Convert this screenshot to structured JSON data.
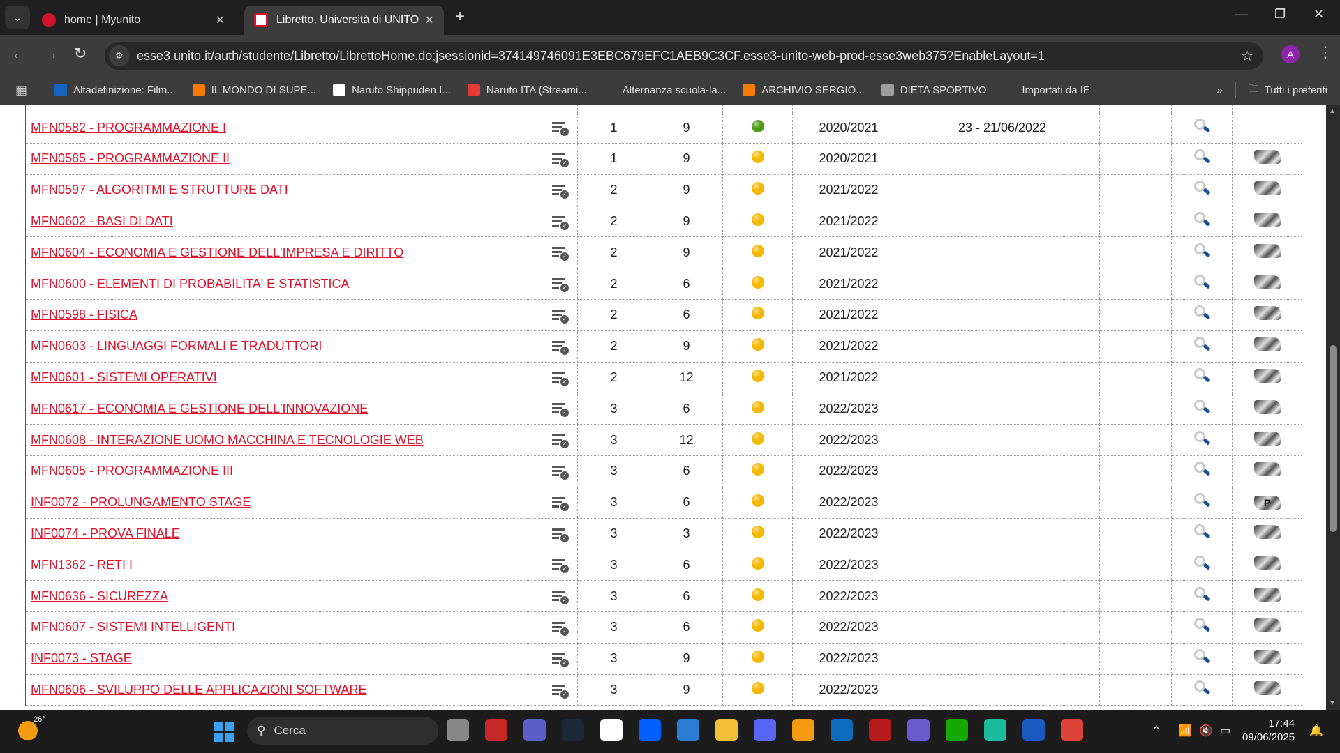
{
  "browser": {
    "tabs": [
      {
        "title": "home | Myunito",
        "active": false
      },
      {
        "title": "Libretto, Università di UNITO",
        "active": true
      }
    ],
    "url": "esse3.unito.it/auth/studente/Libretto/LibrettoHome.do;jsessionid=374149746091E3EBC679EFC1AEB9C3CF.esse3-unito-web-prod-esse3web375?EnableLayout=1",
    "profile_initial": "A",
    "bookmarks": [
      {
        "label": "Altadefinizione: Film...",
        "icon": "hd-icon",
        "color": "#1565c0",
        "glyph": "HD"
      },
      {
        "label": "IL MONDO DI SUPE...",
        "icon": "blogger-icon",
        "color": "#f57c00",
        "glyph": "B"
      },
      {
        "label": "Naruto Shippuden I...",
        "icon": "blank-page-icon",
        "color": "#ffffff",
        "glyph": ""
      },
      {
        "label": "Naruto ITA (Streami...",
        "icon": "play-icon",
        "color": "#e53935",
        "glyph": "▶"
      },
      {
        "label": "Alternanza scuola-la...",
        "icon": "4s-icon",
        "color": "#3c3c3c",
        "glyph": "4s"
      },
      {
        "label": "ARCHIVIO SERGIO...",
        "icon": "blogger-icon",
        "color": "#f57c00",
        "glyph": "B"
      },
      {
        "label": "DIETA SPORTIVO",
        "icon": "globe-icon",
        "color": "#9e9e9e",
        "glyph": ""
      },
      {
        "label": "Importati da IE",
        "icon": "folder-icon",
        "color": "#3c3c3c",
        "glyph": "🗀"
      }
    ],
    "all_bookmarks": "Tutti i preferiti"
  },
  "courses": [
    {
      "name": "MFN0582 - PROGRAMMAZIONE I",
      "year": "1",
      "cfu": "9",
      "status": "passed",
      "aa": "2020/2021",
      "grade_date": "23 - 21/06/2022",
      "book": ""
    },
    {
      "name": "MFN0585 - PROGRAMMAZIONE II",
      "year": "1",
      "cfu": "9",
      "status": "planned",
      "aa": "2020/2021",
      "grade_date": "",
      "book": "book"
    },
    {
      "name": "MFN0597 - ALGORITMI E STRUTTURE DATI",
      "year": "2",
      "cfu": "9",
      "status": "planned",
      "aa": "2021/2022",
      "grade_date": "",
      "book": "book"
    },
    {
      "name": "MFN0602 - BASI DI DATI",
      "year": "2",
      "cfu": "9",
      "status": "planned",
      "aa": "2021/2022",
      "grade_date": "",
      "book": "book"
    },
    {
      "name": "MFN0604 - ECONOMIA E GESTIONE DELL'IMPRESA E DIRITTO",
      "year": "2",
      "cfu": "9",
      "status": "planned",
      "aa": "2021/2022",
      "grade_date": "",
      "book": "book"
    },
    {
      "name": "MFN0600 - ELEMENTI DI PROBABILITA' E STATISTICA",
      "year": "2",
      "cfu": "6",
      "status": "planned",
      "aa": "2021/2022",
      "grade_date": "",
      "book": "book"
    },
    {
      "name": "MFN0598 - FISICA",
      "year": "2",
      "cfu": "6",
      "status": "planned",
      "aa": "2021/2022",
      "grade_date": "",
      "book": "book"
    },
    {
      "name": "MFN0603 - LINGUAGGI FORMALI E TRADUTTORI",
      "year": "2",
      "cfu": "9",
      "status": "planned",
      "aa": "2021/2022",
      "grade_date": "",
      "book": "book"
    },
    {
      "name": "MFN0601 - SISTEMI OPERATIVI",
      "year": "2",
      "cfu": "12",
      "status": "planned",
      "aa": "2021/2022",
      "grade_date": "",
      "book": "book"
    },
    {
      "name": "MFN0617 - ECONOMIA E GESTIONE DELL'INNOVAZIONE",
      "year": "3",
      "cfu": "6",
      "status": "planned",
      "aa": "2022/2023",
      "grade_date": "",
      "book": "book"
    },
    {
      "name": "MFN0608 - INTERAZIONE UOMO MACCHINA E TECNOLOGIE WEB",
      "year": "3",
      "cfu": "12",
      "status": "planned",
      "aa": "2022/2023",
      "grade_date": "",
      "book": "book"
    },
    {
      "name": "MFN0605 - PROGRAMMAZIONE III",
      "year": "3",
      "cfu": "6",
      "status": "planned",
      "aa": "2022/2023",
      "grade_date": "",
      "book": "book"
    },
    {
      "name": "INF0072 - PROLUNGAMENTO STAGE",
      "year": "3",
      "cfu": "6",
      "status": "planned",
      "aa": "2022/2023",
      "grade_date": "",
      "book": "P"
    },
    {
      "name": "INF0074 - PROVA FINALE",
      "year": "3",
      "cfu": "3",
      "status": "planned",
      "aa": "2022/2023",
      "grade_date": "",
      "book": "book"
    },
    {
      "name": "MFN1362 - RETI I",
      "year": "3",
      "cfu": "6",
      "status": "planned",
      "aa": "2022/2023",
      "grade_date": "",
      "book": "book"
    },
    {
      "name": "MFN0636 - SICUREZZA",
      "year": "3",
      "cfu": "6",
      "status": "planned",
      "aa": "2022/2023",
      "grade_date": "",
      "book": "book"
    },
    {
      "name": "MFN0607 - SISTEMI INTELLIGENTI",
      "year": "3",
      "cfu": "6",
      "status": "planned",
      "aa": "2022/2023",
      "grade_date": "",
      "book": "book"
    },
    {
      "name": "INF0073 - STAGE",
      "year": "3",
      "cfu": "9",
      "status": "planned",
      "aa": "2022/2023",
      "grade_date": "",
      "book": "book"
    },
    {
      "name": "MFN0606 - SVILUPPO DELLE APPLICAZIONI SOFTWARE",
      "year": "3",
      "cfu": "9",
      "status": "planned",
      "aa": "2022/2023",
      "grade_date": "",
      "book": "book"
    }
  ],
  "status_colors": {
    "passed": "#4e9a1a",
    "planned": "#f5b800"
  },
  "link_color": "#e0122b",
  "taskbar": {
    "temperature": "26°",
    "search_placeholder": "Cerca",
    "apps": [
      {
        "name": "task-view",
        "color": "#888"
      },
      {
        "name": "app-red",
        "color": "#c62828"
      },
      {
        "name": "teams",
        "color": "#5b5fc7"
      },
      {
        "name": "steam",
        "color": "#1b2838"
      },
      {
        "name": "amazon",
        "color": "#ffffff"
      },
      {
        "name": "dropbox",
        "color": "#0061fe"
      },
      {
        "name": "microsoft-store",
        "color": "#2d7dd2"
      },
      {
        "name": "file-explorer",
        "color": "#f2c037"
      },
      {
        "name": "discord",
        "color": "#5865f2"
      },
      {
        "name": "vpn",
        "color": "#f39c12"
      },
      {
        "name": "outlook",
        "color": "#0f6cbd"
      },
      {
        "name": "app-red-2",
        "color": "#b71c1c"
      },
      {
        "name": "app-p",
        "color": "#6a5acd"
      },
      {
        "name": "upwork",
        "color": "#14a800"
      },
      {
        "name": "app-green",
        "color": "#1abc9c"
      },
      {
        "name": "word",
        "color": "#185abd"
      },
      {
        "name": "chrome",
        "color": "#db4437"
      }
    ],
    "time": "17:44",
    "date": "09/06/2025"
  }
}
